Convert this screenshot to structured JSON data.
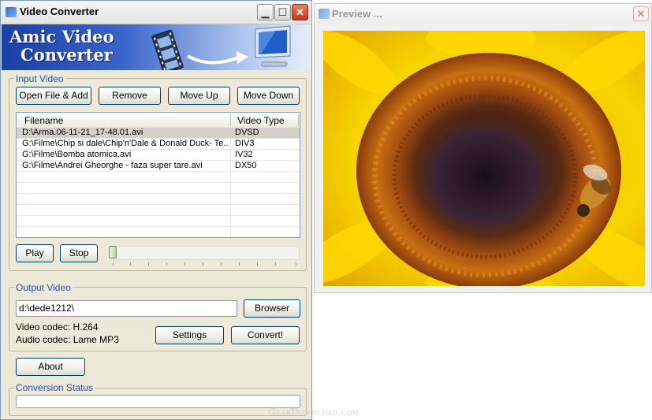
{
  "main_window": {
    "title": "Video Converter",
    "window_buttons": {
      "minimize": "▁",
      "maximize": "☐",
      "close": "✕"
    }
  },
  "banner": {
    "line1": "Amic Video",
    "line2": "Converter"
  },
  "input_group": {
    "label": "Input Video",
    "buttons": {
      "open": "Open File & Add",
      "remove": "Remove",
      "move_up": "Move Up",
      "move_down": "Move Down"
    },
    "columns": [
      "Filename",
      "Video Type"
    ],
    "rows": [
      {
        "filename": "D:\\Arma.06-11-21_17-48.01.avi",
        "type": "DVSD"
      },
      {
        "filename": "G:\\Filme\\Chip si dale\\Chip'n'Dale & Donald Duck- Te...",
        "type": "DIV3"
      },
      {
        "filename": "G:\\Filme\\Bomba atomica.avi",
        "type": "IV32"
      },
      {
        "filename": "G:\\Filme\\Andrei Gheorghe - faza super tare.avi",
        "type": "DX50"
      }
    ],
    "selected_row": 0,
    "play_label": "Play",
    "stop_label": "Stop",
    "position_fraction": 0
  },
  "output_group": {
    "label": "Output Video",
    "path_value": "d:\\dede1212\\",
    "browse_label": "Browser",
    "video_codec": "Video codec: H.264",
    "audio_codec": "Audio codec: Lame MP3",
    "settings_label": "Settings",
    "convert_label": "Convert!"
  },
  "about_label": "About",
  "status_group": {
    "label": "Conversion Status",
    "progress_fraction": 0
  },
  "preview_window": {
    "title": "Preview ...",
    "close": "✕"
  },
  "watermark": "GearDownload.com"
}
